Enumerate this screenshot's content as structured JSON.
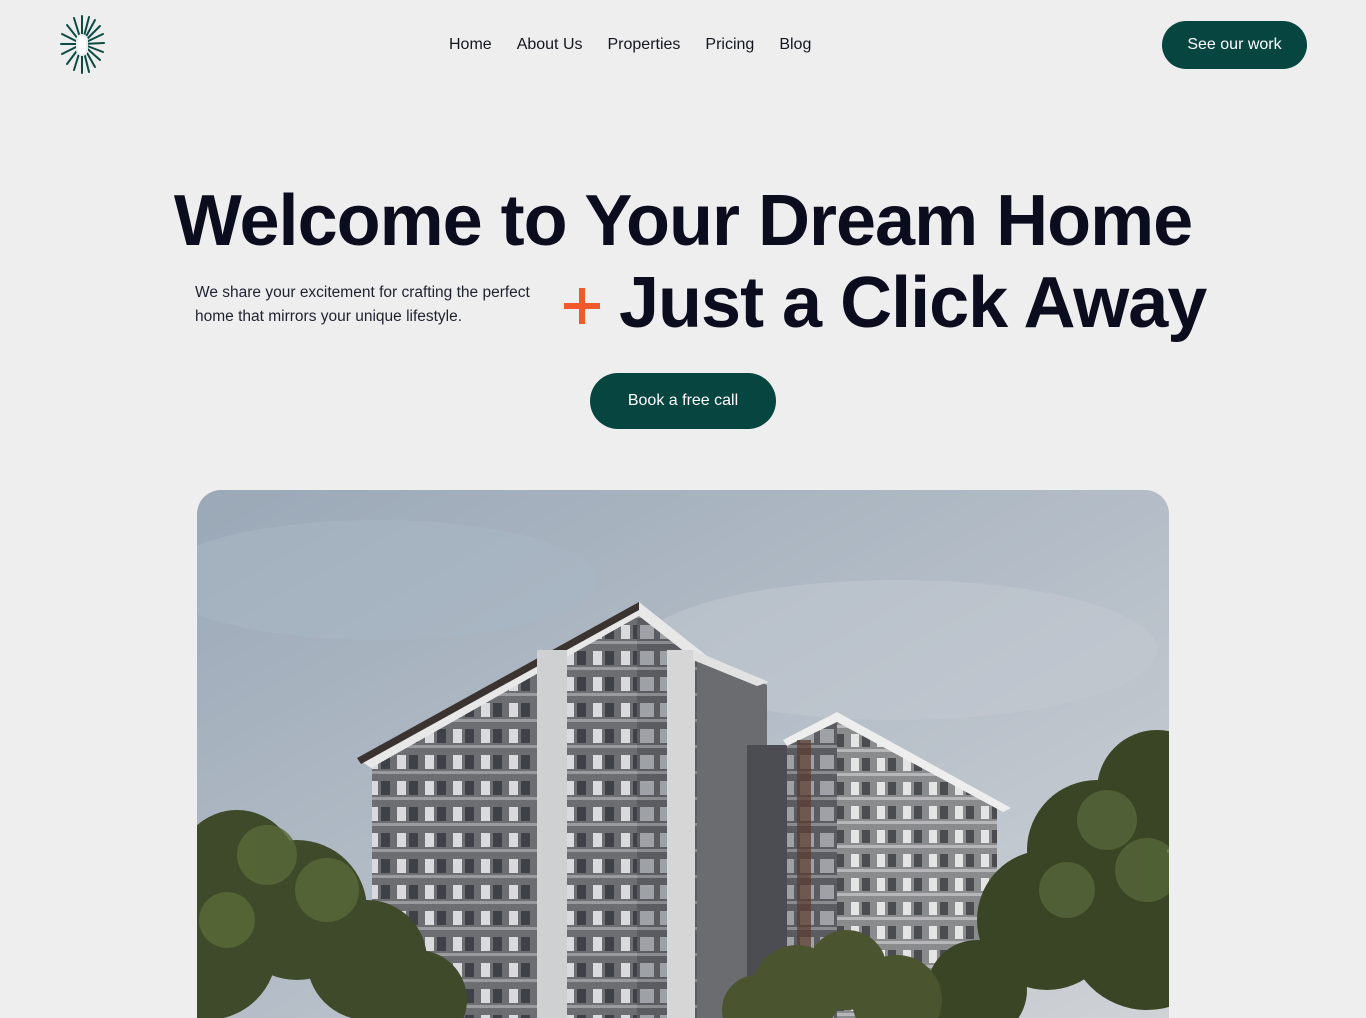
{
  "header": {
    "logo": "brand-logo",
    "nav": [
      {
        "label": "Home"
      },
      {
        "label": "About Us"
      },
      {
        "label": "Properties"
      },
      {
        "label": "Pricing"
      },
      {
        "label": "Blog"
      }
    ],
    "cta_label": "See our work"
  },
  "hero": {
    "headline_line1": "Welcome to Your Dream Home",
    "headline_line2": "Just a Click Away",
    "plus_icon": "plus-icon",
    "subtext": "We share your excitement for crafting the perfect home that mirrors your unique lifestyle.",
    "cta_label": "Book a free call",
    "image": "residential-towers-photo"
  },
  "colors": {
    "background": "#eeeeee",
    "brand_green": "#074540",
    "accent_orange": "#f2592a",
    "heading": "#0b0d1e"
  }
}
